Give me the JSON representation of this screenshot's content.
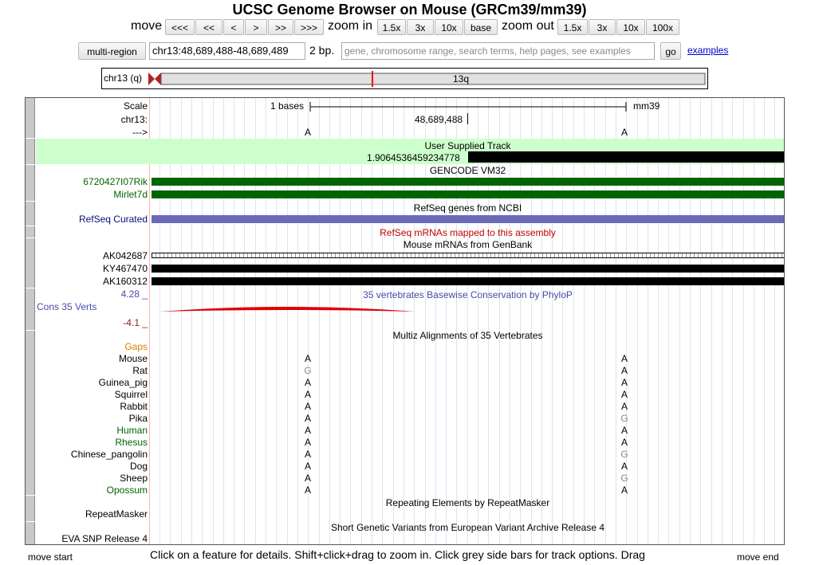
{
  "title": "UCSC Genome Browser on Mouse (GRCm39/mm39)",
  "nav": {
    "move_label": "move",
    "move_buttons": [
      "<<<",
      "<<",
      "<",
      ">",
      ">>",
      ">>>"
    ],
    "zoom_in_label": "zoom in",
    "zoom_in_buttons": [
      "1.5x",
      "3x",
      "10x",
      "base"
    ],
    "zoom_out_label": "zoom out",
    "zoom_out_buttons": [
      "1.5x",
      "3x",
      "10x",
      "100x"
    ]
  },
  "position": {
    "multi_region_label": "multi-region",
    "value": "chr13:48,689,488-48,689,489",
    "size_label": "2 bp.",
    "search_placeholder": "gene, chromosome range, search terms, help pages, see examples",
    "go_label": "go",
    "examples_label": "examples"
  },
  "ideogram": {
    "chrom_label": "chr13 (q)",
    "band_label": "13q"
  },
  "ruler": {
    "scale_label": "Scale",
    "scale_value": "1 bases",
    "assembly": "mm39",
    "chrom_label": "chr13:",
    "coord": "48,689,488",
    "strand_label": "--->",
    "bases": [
      "A",
      "A"
    ]
  },
  "tracks": {
    "user": {
      "title": "User Supplied Track",
      "value": "1.9064536459234778"
    },
    "gencode": {
      "title": "GENCODE VM32",
      "genes": [
        "6720427I07Rik",
        "Mirlet7d"
      ]
    },
    "refseq": {
      "title": "RefSeq genes from NCBI",
      "label": "RefSeq Curated"
    },
    "refseq_mrna": {
      "title": "RefSeq mRNAs mapped to this assembly"
    },
    "mrna": {
      "title": "Mouse mRNAs from GenBank",
      "items": [
        "AK042687",
        "KY467470",
        "AK160312"
      ]
    },
    "phylop": {
      "title": "35 vertebrates Basewise Conservation by PhyloP",
      "label": "Cons 35 Verts",
      "max": "4.28 _",
      "min": "-4.1 _"
    },
    "multiz": {
      "title": "Multiz Alignments of 35 Vertebrates",
      "gaps_label": "Gaps",
      "species": [
        {
          "name": "Mouse",
          "b1": "A",
          "b2": "A"
        },
        {
          "name": "Rat",
          "b1": "G",
          "b2": "A"
        },
        {
          "name": "Guinea_pig",
          "b1": "A",
          "b2": "A"
        },
        {
          "name": "Squirrel",
          "b1": "A",
          "b2": "A"
        },
        {
          "name": "Rabbit",
          "b1": "A",
          "b2": "A"
        },
        {
          "name": "Pika",
          "b1": "A",
          "b2": "G"
        },
        {
          "name": "Human",
          "b1": "A",
          "b2": "A"
        },
        {
          "name": "Rhesus",
          "b1": "A",
          "b2": "A"
        },
        {
          "name": "Chinese_pangolin",
          "b1": "A",
          "b2": "G"
        },
        {
          "name": "Dog",
          "b1": "A",
          "b2": "A"
        },
        {
          "name": "Sheep",
          "b1": "A",
          "b2": "G"
        },
        {
          "name": "Opossum",
          "b1": "A",
          "b2": "A"
        }
      ]
    },
    "repeatmasker": {
      "title": "Repeating Elements by RepeatMasker",
      "label": "RepeatMasker"
    },
    "eva": {
      "title": "Short Genetic Variants from European Variant Archive Release 4",
      "label": "EVA SNP Release 4"
    }
  },
  "footer": {
    "move_start": "move start",
    "move_end": "move end",
    "help": "Click on a feature for details. Shift+click+drag to zoom in. Click grey side bars for track options. Drag"
  },
  "colors": {
    "gencode": "#006400",
    "refseq": "#0c0c78",
    "refseq_bar": "#6a6ab8",
    "mrna_title": "#c00000",
    "phylop": "#4a4aa8",
    "user_bg": "#ccffcc",
    "human": "#006400",
    "gaps": "#d48000"
  }
}
